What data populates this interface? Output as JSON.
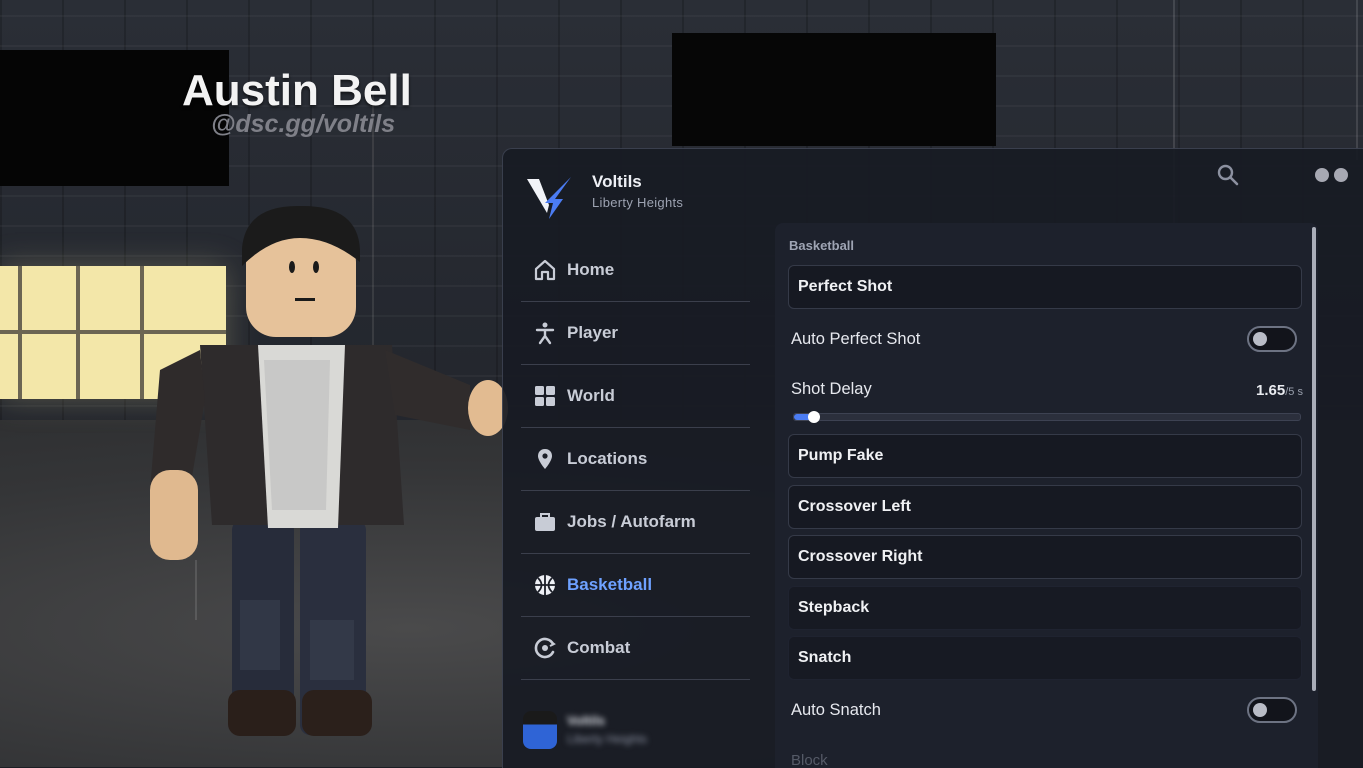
{
  "nametag": {
    "name": "Austin Bell",
    "handle": "@dsc.gg/voltils"
  },
  "brand": {
    "title": "Voltils",
    "subtitle": "Liberty Heights",
    "accent": "#4b7cf3"
  },
  "sidebar": {
    "items": [
      {
        "label": "Home",
        "icon": "home-icon"
      },
      {
        "label": "Player",
        "icon": "person-icon"
      },
      {
        "label": "World",
        "icon": "grid-icon"
      },
      {
        "label": "Locations",
        "icon": "map-pin-icon"
      },
      {
        "label": "Jobs / Autofarm",
        "icon": "briefcase-icon"
      },
      {
        "label": "Basketball",
        "icon": "basketball-icon",
        "active": true
      },
      {
        "label": "Combat",
        "icon": "combat-icon"
      }
    ],
    "profile": {
      "name": "Voltils",
      "subtitle": "Liberty Heights"
    }
  },
  "content": {
    "section_title": "Basketball",
    "perfect_shot": "Perfect Shot",
    "auto_perfect_shot": {
      "label": "Auto Perfect Shot",
      "on": false
    },
    "shot_delay": {
      "label": "Shot Delay",
      "value": "1.65",
      "max": "/5",
      "unit": "s",
      "fraction": 0.04
    },
    "pump_fake": "Pump Fake",
    "crossover_left": "Crossover Left",
    "crossover_right": "Crossover Right",
    "stepback": "Stepback",
    "snatch": "Snatch",
    "auto_snatch": {
      "label": "Auto Snatch",
      "on": false
    },
    "next_item": "Block"
  }
}
